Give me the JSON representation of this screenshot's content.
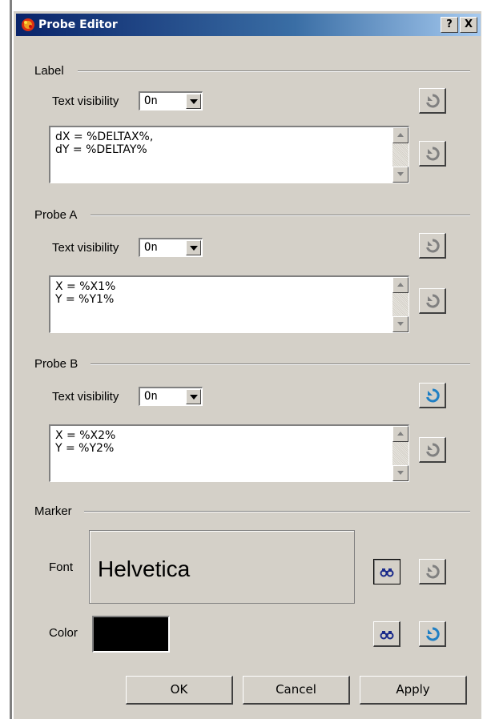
{
  "window": {
    "title": "Probe Editor",
    "help_button": "?",
    "close_button": "X"
  },
  "sections": {
    "label": {
      "title": "Label",
      "text_visibility_label": "Text visibility",
      "text_visibility_value": "On",
      "text": "dX = %DELTAX%,\ndY = %DELTAY%"
    },
    "probe_a": {
      "title": "Probe A",
      "text_visibility_label": "Text visibility",
      "text_visibility_value": "On",
      "text": "X = %X1%\nY = %Y1%"
    },
    "probe_b": {
      "title": "Probe B",
      "text_visibility_label": "Text visibility",
      "text_visibility_value": "On",
      "text": "X = %X2%\nY = %Y2%"
    },
    "marker": {
      "title": "Marker",
      "font_label": "Font",
      "font_value": "Helvetica",
      "color_label": "Color",
      "color_value": "#000000"
    }
  },
  "buttons": {
    "ok": "OK",
    "cancel": "Cancel",
    "apply": "Apply"
  },
  "colors": {
    "title_gradient_start": "#0a246a",
    "title_gradient_end": "#a6caf0",
    "dialog_background": "#d4d0c8",
    "reset_icon_disabled": "#808080",
    "reset_icon_active": "#1f7fc4",
    "binoculars_icon": "#1a2a8a"
  }
}
